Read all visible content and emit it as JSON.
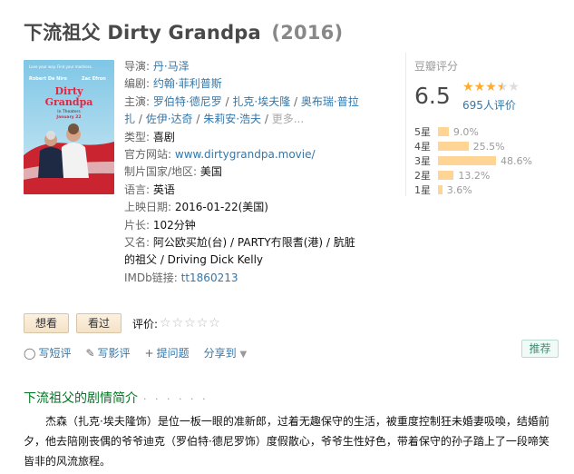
{
  "header": {
    "title_cn": "下流祖父",
    "title_en": "Dirty Grandpa",
    "year": "(2016)"
  },
  "poster": {
    "tagline": "Love your way. Find your madness.",
    "actor1": "Robert De Niro",
    "actor2": "Zac Efron",
    "title_line1": "Dirty",
    "title_line2": "Grandpa",
    "in_theaters": "In Theaters",
    "date": "January 22"
  },
  "info": {
    "director_label": "导演:",
    "director": "丹·马泽",
    "writer_label": "编剧:",
    "writer": "约翰·菲利普斯",
    "cast_label": "主演:",
    "cast": [
      "罗伯特·德尼罗",
      "扎克·埃夫隆",
      "奥布瑞·普拉扎",
      "佐伊·达奇",
      "朱莉安·浩夫"
    ],
    "cast_more": "更多...",
    "genre_label": "类型:",
    "genre": "喜剧",
    "site_label": "官方网站:",
    "site": "www.dirtygrandpa.movie/",
    "country_label": "制片国家/地区:",
    "country": "美国",
    "lang_label": "语言:",
    "lang": "英语",
    "release_label": "上映日期:",
    "release": "2016-01-22(美国)",
    "runtime_label": "片长:",
    "runtime": "102分钟",
    "aka_label": "又名:",
    "aka": "阿公欧买尬(台) / PARTY冇限耆(港) / 肮脏的祖父 / Driving Dick Kelly",
    "imdb_label": "IMDb链接:",
    "imdb": "tt1860213"
  },
  "rating": {
    "label": "豆瓣评分",
    "score": "6.5",
    "stars_filled": 3.5,
    "people": "695人评价",
    "bars": [
      {
        "label": "5星",
        "pct": "9.0%",
        "value": 9.0
      },
      {
        "label": "4星",
        "pct": "25.5%",
        "value": 25.5
      },
      {
        "label": "3星",
        "pct": "48.6%",
        "value": 48.6
      },
      {
        "label": "2星",
        "pct": "13.2%",
        "value": 13.2
      },
      {
        "label": "1星",
        "pct": "3.6%",
        "value": 3.6
      }
    ]
  },
  "actions": {
    "want": "想看",
    "seen": "看过",
    "rate_label": "评价:",
    "short_review": "写短评",
    "long_review": "写影评",
    "question": "提问题",
    "share": "分享到",
    "recommend": "推荐"
  },
  "synopsis": {
    "title": "下流祖父的剧情简介",
    "dots": "· · · · · ·",
    "text": "杰森（扎克·埃夫隆饰）是位一板一眼的准新郎，过着无趣保守的生活，被重度控制狂未婚妻吸喚，结婚前夕，他去陪刚丧偶的爷爷迪克（罗伯特·德尼罗饰）度假散心，爷爷生性好色，带着保守的孙子踏上了一段啼笑皆非的风流旅程。"
  },
  "colors": {
    "link": "#3377aa",
    "star": "#ffac2d",
    "bar": "#ffd596",
    "synopsis_title": "#007722"
  }
}
